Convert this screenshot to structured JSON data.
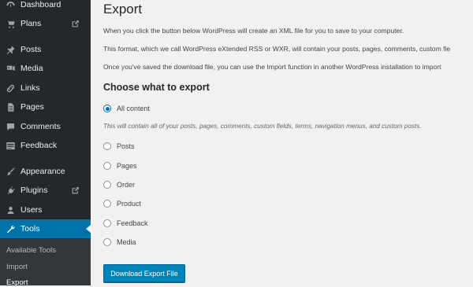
{
  "sidebar": {
    "items": [
      {
        "label": "Dashboard",
        "icon": "dashboard-icon"
      },
      {
        "label": "Plans",
        "icon": "cart-icon",
        "external": true
      },
      {
        "label": "Posts",
        "icon": "pin-icon"
      },
      {
        "label": "Media",
        "icon": "media-icon"
      },
      {
        "label": "Links",
        "icon": "links-icon"
      },
      {
        "label": "Pages",
        "icon": "pages-icon"
      },
      {
        "label": "Comments",
        "icon": "comments-icon"
      },
      {
        "label": "Feedback",
        "icon": "feedback-icon"
      },
      {
        "label": "Appearance",
        "icon": "brush-icon"
      },
      {
        "label": "Plugins",
        "icon": "plugins-icon",
        "external": true
      },
      {
        "label": "Users",
        "icon": "users-icon"
      },
      {
        "label": "Tools",
        "icon": "wrench-icon",
        "active": true
      }
    ],
    "submenu": [
      "Available Tools",
      "Import",
      "Export"
    ]
  },
  "main": {
    "title": "Export",
    "paragraphs": [
      "When you click the button below WordPress will create an XML file for you to save to your computer.",
      "This format, which we call WordPress eXtended RSS or WXR, will contain your posts, pages, comments, custom fie",
      "Once you've saved the download file, you can use the Import function in another WordPress installation to import"
    ],
    "section_title": "Choose what to export",
    "options": [
      {
        "label": "All content",
        "checked": true
      },
      {
        "label": "Posts",
        "checked": false
      },
      {
        "label": "Pages",
        "checked": false
      },
      {
        "label": "Order",
        "checked": false
      },
      {
        "label": "Product",
        "checked": false
      },
      {
        "label": "Feedback",
        "checked": false
      },
      {
        "label": "Media",
        "checked": false
      }
    ],
    "all_content_desc": "This will contain all of your posts, pages, comments, custom fields, terms, navigation menus, and custom posts.",
    "button_label": "Download Export File"
  },
  "colors": {
    "sidebar_bg": "#23282d",
    "accent": "#0073aa",
    "button": "#0085ba"
  }
}
